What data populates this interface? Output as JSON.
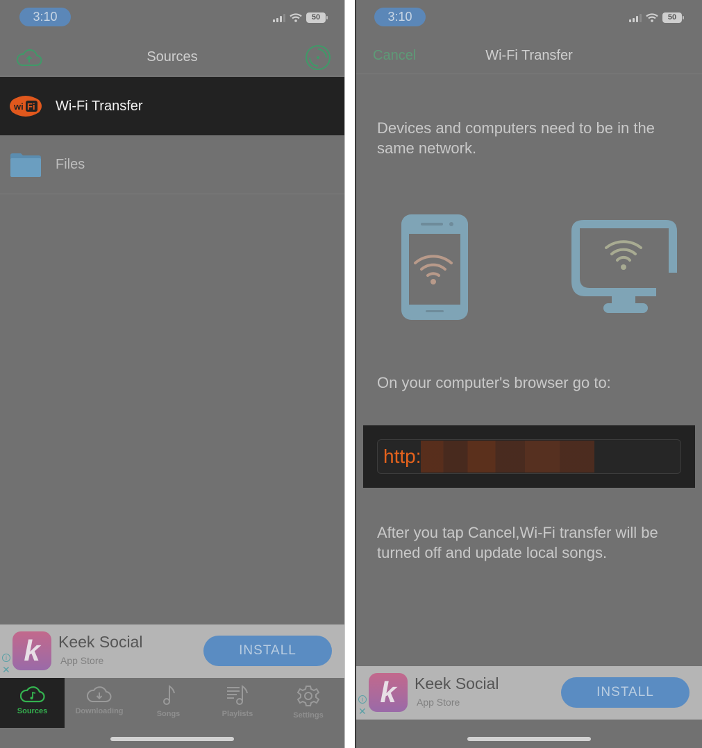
{
  "left": {
    "status_bar": {
      "time": "3:10",
      "battery": "50"
    },
    "nav": {
      "title": "Sources",
      "left_icon": "cloud-upload-icon",
      "right_icon": "disc-icon"
    },
    "sources": [
      {
        "label": "Wi-Fi Transfer",
        "icon": "wifi-logo-icon",
        "selected": true
      },
      {
        "label": "Files",
        "icon": "folder-icon",
        "selected": false
      }
    ],
    "ad": {
      "title": "Keek Social",
      "subtitle": "App Store",
      "cta": "INSTALL",
      "app_letter": "k"
    },
    "tabs": [
      {
        "label": "Sources",
        "icon": "cloud-music-icon",
        "active": true
      },
      {
        "label": "Downloading",
        "icon": "cloud-download-icon",
        "active": false
      },
      {
        "label": "Songs",
        "icon": "music-note-icon",
        "active": false
      },
      {
        "label": "Playlists",
        "icon": "playlist-icon",
        "active": false
      },
      {
        "label": "Settings",
        "icon": "gear-icon",
        "active": false
      }
    ]
  },
  "right": {
    "status_bar": {
      "time": "3:10",
      "battery": "50"
    },
    "nav": {
      "title": "Wi-Fi Transfer",
      "cancel_label": "Cancel"
    },
    "network_note": "Devices and computers need to be in the same network.",
    "browser_prompt": "On your computer's browser go to:",
    "url_prefix": "http:",
    "url_redacted": true,
    "cancel_note": "After you tap Cancel,Wi-Fi transfer will be turned off and update local songs.",
    "ad": {
      "title": "Keek Social",
      "subtitle": "App Store",
      "cta": "INSTALL",
      "app_letter": "k"
    }
  },
  "colors": {
    "accent_green": "#34b24f",
    "url_orange": "#e4621d",
    "device_blue": "#7fa4b6",
    "install_blue": "#5a8cc2"
  }
}
